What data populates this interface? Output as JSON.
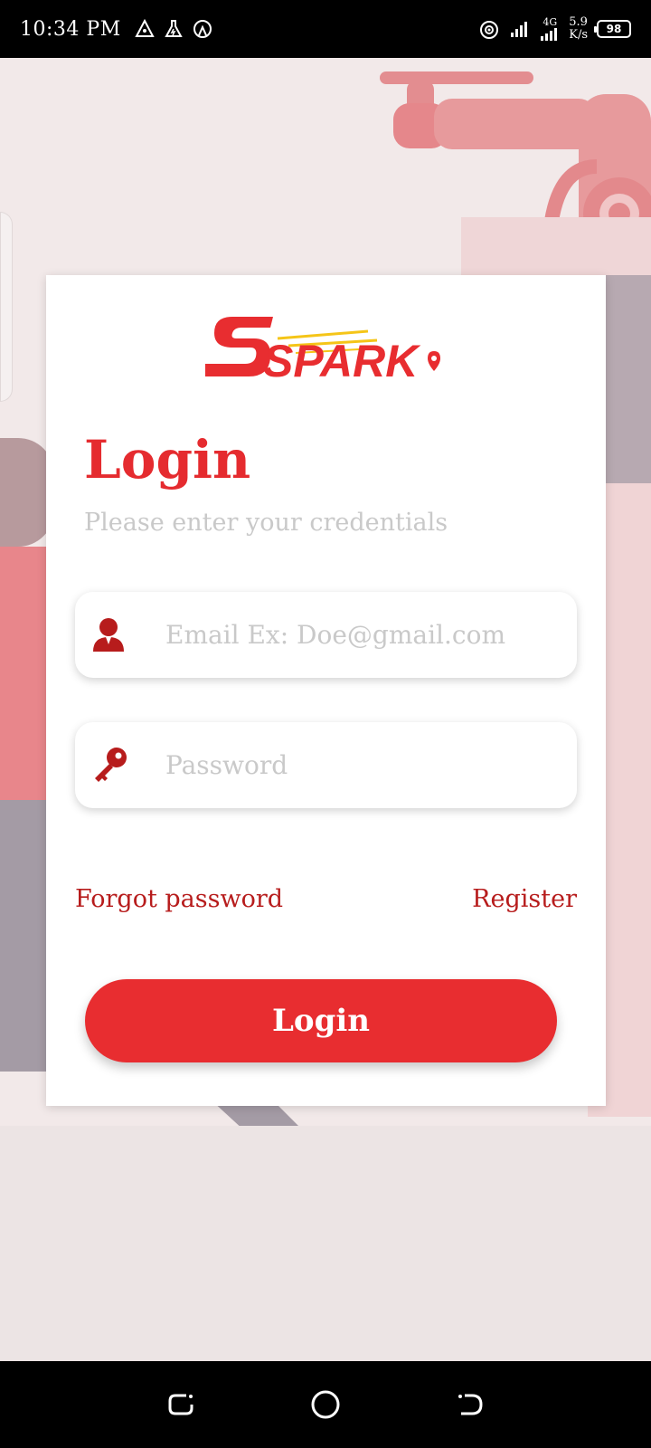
{
  "status_bar": {
    "time": "10:34 PM",
    "network_type": "4G",
    "speed_value": "5.9",
    "speed_unit": "K/s",
    "battery": "98"
  },
  "logo": {
    "text": "SPARK"
  },
  "login": {
    "title": "Login",
    "subtitle": "Please enter your credentials",
    "email_placeholder": "Email Ex: Doe@gmail.com",
    "password_placeholder": "Password",
    "forgot_password": "Forgot password",
    "register": "Register",
    "login_button": "Login"
  },
  "colors": {
    "accent": "#e82d30",
    "link": "#b71c1c",
    "background": "#f2e9e9"
  },
  "icons": {
    "email": "user-icon",
    "password": "key-icon"
  }
}
